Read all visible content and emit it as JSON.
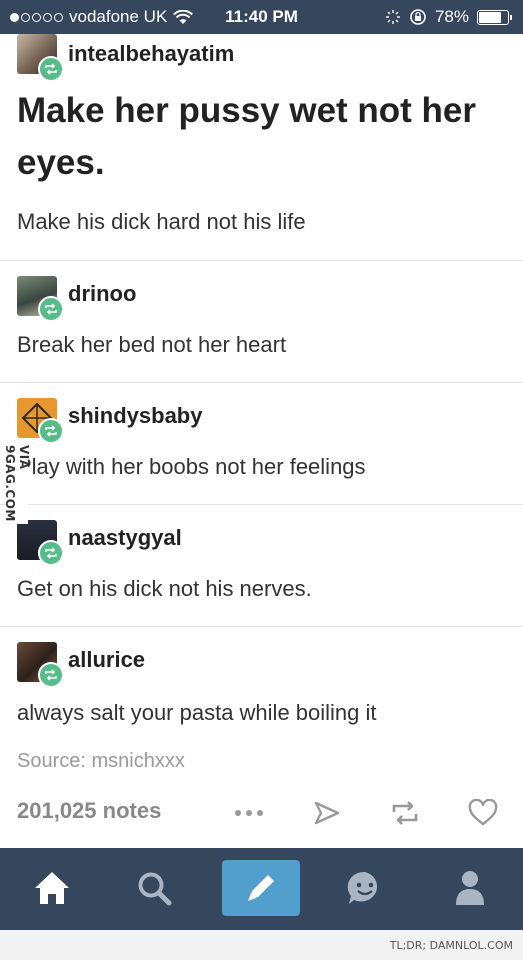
{
  "status_bar": {
    "carrier": "vodafone UK",
    "time": "11:40 PM",
    "battery": "78%",
    "battery_level": 0.78
  },
  "posts": [
    {
      "username": "intealbehayatim",
      "headline": "Make her pussy wet not her eyes.",
      "text": "Make his dick hard not his life"
    },
    {
      "username": "drinoo",
      "text": "Break her bed not her heart"
    },
    {
      "username": "shindysbaby",
      "text": "Play with her boobs not her feelings"
    },
    {
      "username": "naastygyal",
      "text": "Get on his dick not his nerves."
    },
    {
      "username": "allurice",
      "text": "always salt your pasta while boiling it"
    }
  ],
  "source": "Source: msnichxxx",
  "notes": "201,025 notes",
  "actions": [
    "more-icon",
    "share-icon",
    "reblog-icon",
    "like-icon"
  ],
  "nav": [
    "home-icon",
    "search-icon",
    "compose-icon",
    "messaging-icon",
    "account-icon"
  ],
  "watermark": "VIA 9GAG.COM",
  "footer": "TL;DR; DAMNLOL.COM",
  "colors": {
    "bar": "#36465d",
    "reblog": "#56bc8a",
    "compose": "#529ecc"
  }
}
